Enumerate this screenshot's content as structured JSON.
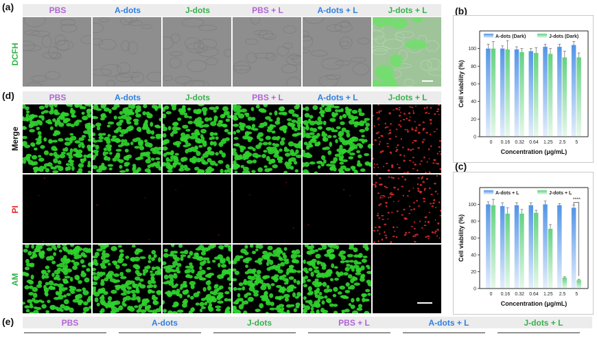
{
  "panels": {
    "a": "(a)",
    "b": "(b)",
    "c": "(c)",
    "d": "(d)",
    "e": "(e)"
  },
  "groups": [
    "PBS",
    "A-dots",
    "J-dots",
    "PBS + L",
    "A-dots + L",
    "J-dots + L"
  ],
  "group_colors": [
    "#b163d6",
    "#2e7fe0",
    "#35b24a",
    "#b163d6",
    "#2e7fe0",
    "#35b24a"
  ],
  "row_labels": {
    "dcfh": "DCFH",
    "merge": "Merge",
    "pi": "PI",
    "am": "AM"
  },
  "row_label_colors": {
    "dcfh": "#35b24a",
    "merge": "#111111",
    "pi": "#e2262a",
    "am": "#35b24a"
  },
  "panel_e_groups": [
    "PBS",
    "A-dots",
    "J-dots",
    "PBS + L",
    "A-dots + L",
    "J-dots + L"
  ],
  "chart_data": [
    {
      "type": "bar",
      "panel": "b",
      "categories": [
        "0",
        "0.16",
        "0.32",
        "0.64",
        "1.25",
        "2.5",
        "5"
      ],
      "series": [
        {
          "name": "A-dots (Dark)",
          "values": [
            100,
            100,
            99,
            97,
            102,
            102,
            104
          ],
          "errors": [
            5,
            3,
            3,
            3,
            3,
            3,
            4
          ],
          "color": "#4a8fe6"
        },
        {
          "name": "J-dots (Dark)",
          "values": [
            100,
            99,
            96,
            95,
            94,
            90,
            90
          ],
          "errors": [
            8,
            10,
            4,
            6,
            6,
            7,
            5
          ],
          "color": "#5ccf7a"
        }
      ],
      "xlabel": "Concentration (μg/mL)",
      "ylabel": "Cell viability (%)",
      "ylim": [
        0,
        120
      ],
      "yticks": [
        0,
        20,
        40,
        60,
        80,
        100
      ],
      "legend": "top"
    },
    {
      "type": "bar",
      "panel": "c",
      "categories": [
        "0",
        "0.16",
        "0.32",
        "0.64",
        "1.25",
        "2.5",
        "5"
      ],
      "series": [
        {
          "name": "A-dots + L",
          "values": [
            100,
            98,
            99,
            99,
            100,
            99,
            96
          ],
          "errors": [
            3,
            4,
            3,
            3,
            4,
            2,
            3
          ],
          "color": "#4a8fe6"
        },
        {
          "name": "J-dots + L",
          "values": [
            99,
            89,
            89,
            90,
            71,
            13,
            10
          ],
          "errors": [
            7,
            7,
            5,
            3,
            5,
            1,
            1
          ],
          "color": "#5ccf7a"
        }
      ],
      "xlabel": "Concentration (μg/mL)",
      "ylabel": "Cell viability (%)",
      "ylim": [
        0,
        120
      ],
      "yticks": [
        0,
        20,
        40,
        60,
        80,
        100
      ],
      "legend": "top",
      "annotation": "****"
    }
  ]
}
